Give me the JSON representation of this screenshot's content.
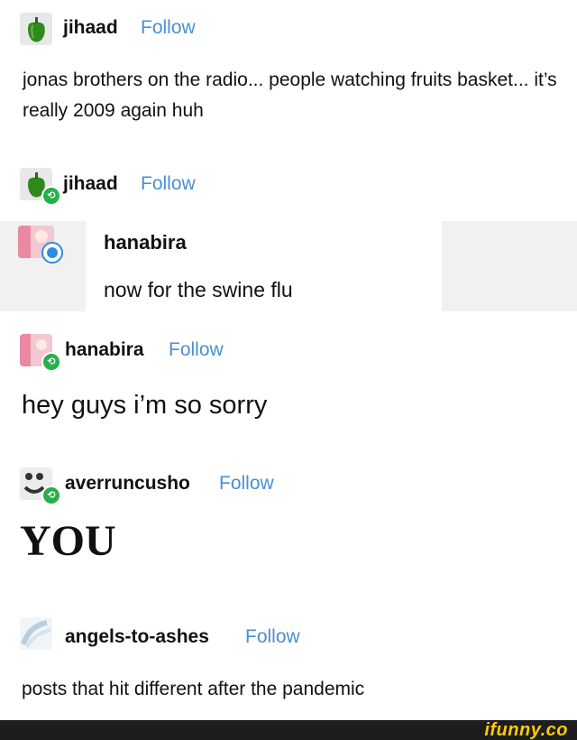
{
  "posts": [
    {
      "username": "jihaad",
      "follow": "Follow",
      "text": "jonas brothers on the radio... people watching fruits basket... it’s really 2009 again huh"
    },
    {
      "username": "jihaad",
      "follow": "Follow"
    },
    {
      "username": "hanabira",
      "text": "now for the swine flu"
    },
    {
      "username": "hanabira",
      "follow": "Follow",
      "text": "hey guys i’m so sorry"
    },
    {
      "username": "averruncusho",
      "follow": "Follow",
      "text": "YOU"
    },
    {
      "username": "angels-to-ashes",
      "follow": "Follow",
      "text": "posts that hit different after the pandemic"
    }
  ],
  "watermark": "ifunny.co",
  "colors": {
    "follow": "#4a8fd0",
    "reblog_badge": "#25b14a",
    "quote_bg": "#f1f1f1",
    "bar": "#1d1d1d",
    "watermark": "#ffcc00"
  },
  "icons": {
    "jihaad_avatar": "green-pepper-icon",
    "reblog": "reblog-icon",
    "hanabira_avatar": "anime-girl-avatar",
    "averruncusho_avatar": "smiley-face-avatar",
    "angels_avatar": "sky-cloud-avatar"
  }
}
